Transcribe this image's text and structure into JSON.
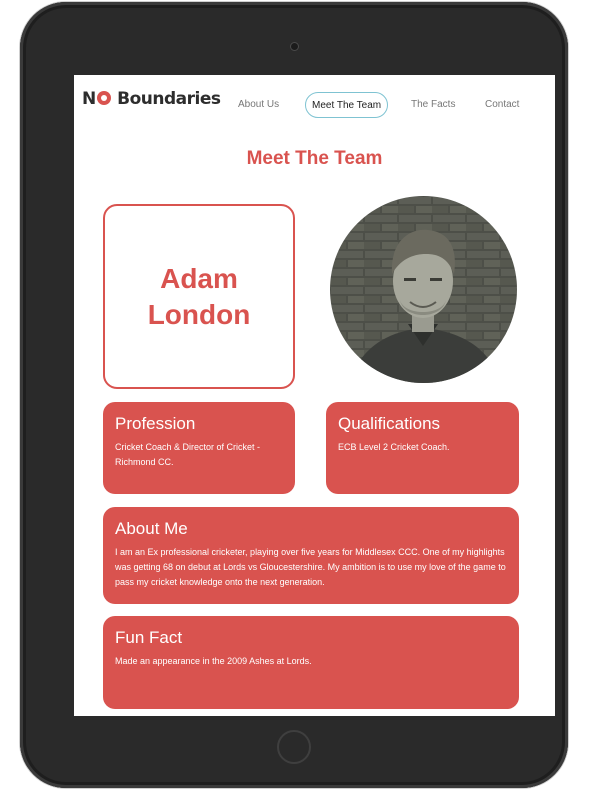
{
  "brand": {
    "logo_text_left": "N",
    "logo_text_right": "Boundaries"
  },
  "nav": {
    "items": [
      {
        "label": "About Us"
      },
      {
        "label": "Meet The Team"
      },
      {
        "label": "The Facts"
      },
      {
        "label": "Contact"
      }
    ],
    "active": "Meet The Team"
  },
  "page": {
    "title": "Meet The Team"
  },
  "profile": {
    "name": "Adam London",
    "photo_alt": "Portrait photo"
  },
  "cards": {
    "profession": {
      "heading": "Profession",
      "body": "Cricket Coach & Director of Cricket - Richmond CC."
    },
    "qualifications": {
      "heading": "Qualifications",
      "body": "ECB Level 2 Cricket Coach."
    },
    "about": {
      "heading": "About Me",
      "body": "I am an Ex professional cricketer, playing over five years for Middlesex CCC. One of my highlights was getting 68 on debut at Lords vs Gloucestershire. My ambition is to use my love of the game to pass my cricket knowledge onto the next generation."
    },
    "fun_fact": {
      "heading": "Fun Fact",
      "body": "Made an appearance in the 2009 Ashes at Lords."
    }
  },
  "colors": {
    "accent": "#d9534f",
    "nav_active_border": "#7fc3d2",
    "device": "#2a2a2a"
  }
}
